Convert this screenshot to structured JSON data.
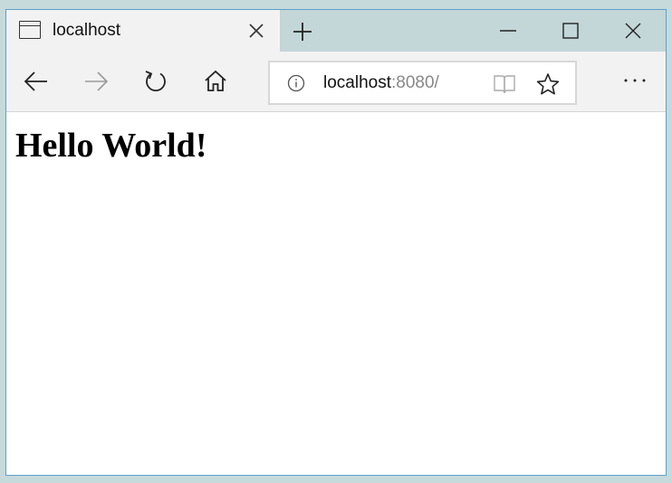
{
  "tab": {
    "title": "localhost"
  },
  "address_bar": {
    "host": "localhost",
    "port_path": ":8080/"
  },
  "page": {
    "heading": "Hello World!"
  },
  "icons": {
    "tab_page": "page-icon",
    "tab_close": "close-icon",
    "new_tab": "plus-icon",
    "minimize": "minimize-icon",
    "maximize": "maximize-icon",
    "close_window": "close-icon",
    "back": "arrow-left-icon",
    "forward": "arrow-right-icon",
    "refresh": "refresh-icon",
    "home": "home-icon",
    "site_info": "info-icon",
    "reading_view": "book-icon",
    "favorite": "star-icon",
    "more": "ellipsis-icon"
  },
  "colors": {
    "titlebar": "#c3d6d8",
    "tab_active": "#f2f2f2",
    "window_border": "#5ea0c8",
    "url_muted": "#888888"
  }
}
